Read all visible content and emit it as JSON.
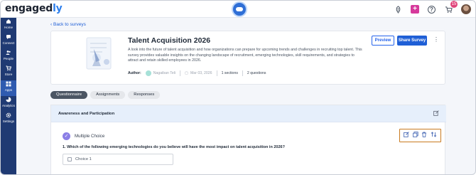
{
  "brand": {
    "logo_main": "engaged",
    "logo_accent": "ly"
  },
  "header": {
    "notification_badge": "15",
    "icons": [
      "rocket-icon",
      "add-icon",
      "help-icon",
      "cart-icon",
      "avatar"
    ]
  },
  "sidebar": {
    "items": [
      {
        "label": "Home",
        "icon": "home-icon",
        "active": false
      },
      {
        "label": "Connect",
        "icon": "connect-icon",
        "active": false
      },
      {
        "label": "People",
        "icon": "people-icon",
        "active": false
      },
      {
        "label": "Store",
        "icon": "store-icon",
        "active": false
      },
      {
        "label": "Apps",
        "icon": "apps-icon",
        "active": true
      },
      {
        "label": "Analytics",
        "icon": "analytics-icon",
        "active": false
      },
      {
        "label": "Settings",
        "icon": "settings-icon",
        "active": false
      }
    ]
  },
  "back_link": "Back to surveys",
  "survey": {
    "title": "Talent Acquisition 2026",
    "description": "A look into the future of talent acquisition and how organizations can prepare for upcoming trends and challenges in recruiting top talent. This survey provides valuable insights on the changing landscape of recruitment, emerging technologies, skill requirements, and strategies to attract and retain skilled employees in 2026.",
    "author_label": "Author:",
    "author_name": "Nagaiban Teli",
    "date": "Mar 03, 2026",
    "sections": "1 sections",
    "questions": "2 questions",
    "preview_label": "Preview",
    "share_label": "Share Survey"
  },
  "tabs": [
    {
      "label": "Questionnaire",
      "active": true
    },
    {
      "label": "Assignments",
      "active": false
    },
    {
      "label": "Responses",
      "active": false
    }
  ],
  "section": {
    "title": "Awareness and Participation",
    "question_type": "Multiple Choice",
    "question": "1. Which of the following emerging technologies do you believe will have the most impact on talent acquisition in 2026?",
    "choice_1": "Choice 1"
  },
  "colors": {
    "sidebar_bg": "#1f3a73",
    "primary": "#1f5fd6",
    "highlight_border": "#c97a1f",
    "section_header_bg": "#e6effb"
  }
}
